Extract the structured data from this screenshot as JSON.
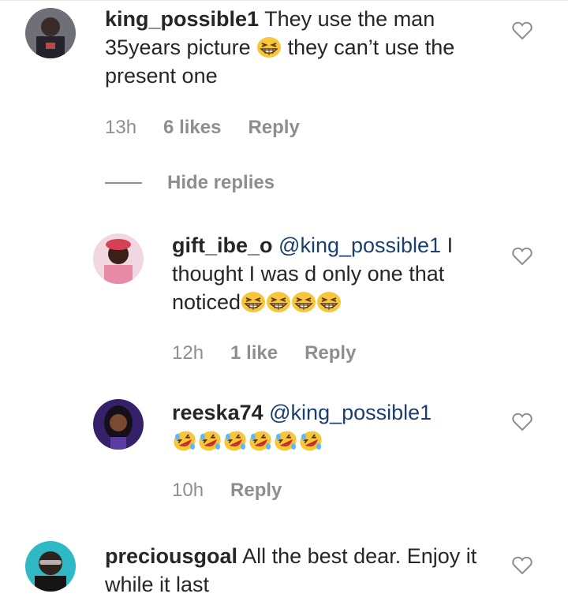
{
  "comments": [
    {
      "username": "king_possible1",
      "text_a": "They use the man",
      "text_b": "35years picture",
      "text_c": "they can’t use the",
      "text_d": "present one",
      "time": "13h",
      "likes": "6 likes",
      "reply": "Reply"
    },
    {
      "username": "gift_ibe_o",
      "mention": "@king_possible1",
      "text_a": "I",
      "text_b": "thought I was d only one that",
      "text_c": "noticed",
      "time": "12h",
      "likes": "1 like",
      "reply": "Reply"
    },
    {
      "username": "reeska74",
      "mention": "@king_possible1",
      "time": "10h",
      "reply": "Reply"
    },
    {
      "username": "preciousgoal",
      "text_a": "All the best dear. Enjoy it",
      "text_b": "while it last"
    }
  ],
  "hide_replies": "Hide replies",
  "icons": {
    "heart": "heart-outline-icon",
    "grin": "grinning-squinting-face-emoji",
    "laugh": "rolling-laughing-face-emoji"
  },
  "colors": {
    "text": "#262626",
    "meta": "#8e8e8e",
    "mention": "#1a3f6e"
  }
}
